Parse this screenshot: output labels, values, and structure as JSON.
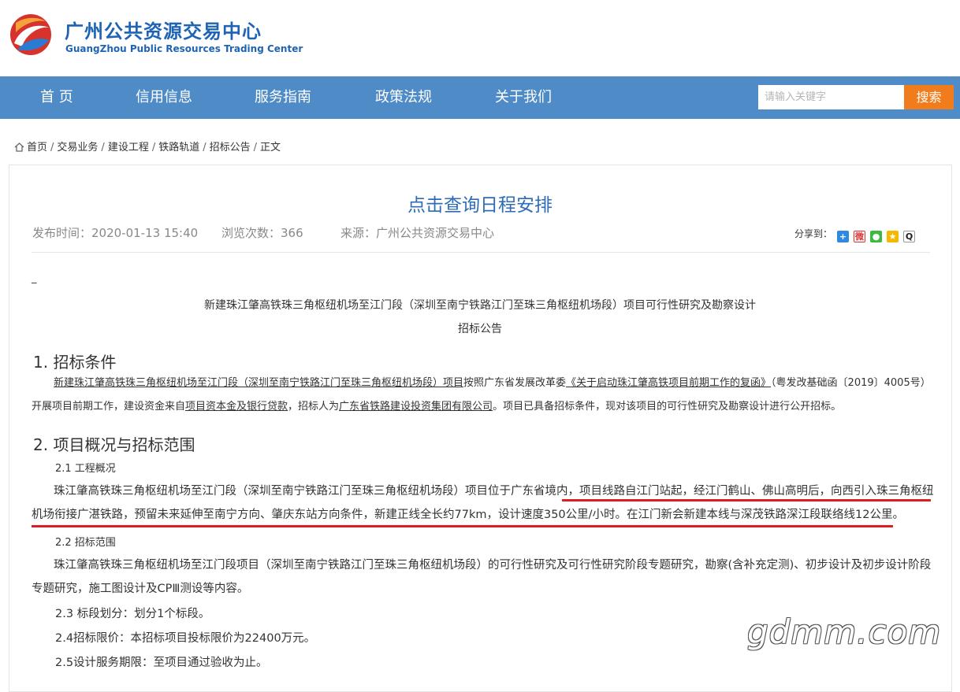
{
  "header": {
    "title": "广州公共资源交易中心",
    "subtitle": "GuangZhou Public Resources Trading Center",
    "logo_icon": "swirl-logo-icon"
  },
  "nav": {
    "items": [
      "首 页",
      "信用信息",
      "服务指南",
      "政策法规",
      "关于我们"
    ],
    "search_placeholder": "请输入关键字",
    "search_button": "搜索"
  },
  "breadcrumb": {
    "items": [
      "首页",
      "交易业务",
      "建设工程",
      "铁路轨道",
      "招标公告",
      "正文"
    ],
    "separator": "/"
  },
  "article": {
    "title": "点击查询日程安排",
    "publish_time": "发布时间：2020-01-13 15:40",
    "views": "浏览次数：366",
    "source": "来源：广州公共资源交易中心",
    "share_label": "分享到：",
    "dash": "_",
    "heading_line1": "新建珠江肇高铁珠三角枢纽机场至江门段（深圳至南宁铁路江门至珠三角枢纽机场段）项目可行性研究及勘察设计",
    "heading_line2": "招标公告"
  },
  "sections": {
    "s1_title": "1. 招标条件",
    "s1_p_a": "新建珠江肇高铁珠三角枢纽机场至江门段（深圳至南宁铁路江门至珠三角枢纽机场段）项目",
    "s1_p_b": "按照广东省发展改革委",
    "s1_p_c": "《关于启动珠江肇高铁项目前期工作的复函》",
    "s1_p_d": "（粤发改基础函〔2019〕4005号）开展项目前期工作，建设资金来自",
    "s1_p_e": "项目资本金及银行贷款",
    "s1_p_f": "，招标人为",
    "s1_p_g": "广东省铁路建设投资集团有限公司",
    "s1_p_h": "。项目已具备招标条件，现对该项目的可行性研究及勘察设计进行公开招标。",
    "s2_title": "2. 项目概况与招标范围",
    "s2_1": "2.1 工程概况",
    "s2_1_p": "珠江肇高铁珠三角枢纽机场至江门段（深圳至南宁铁路江门至珠三角枢纽机场段）项目位于广东省境内，项目线路自江门站起，经江门鹤山、佛山高明后，向西引入珠三角枢纽机场衔接广湛铁路，预留未来延伸至南宁方向、肇庆东站方向条件，新建正线全长约77km，设计速度350公里/小时。在江门新会新建本线与深茂铁路深江段联络线12公里。",
    "s2_2": "2.2 招标范围",
    "s2_2_p": "珠江肇高铁珠三角枢纽机场至江门段项目（深圳至南宁铁路江门至珠三角枢纽机场段）的可行性研究及可行性研究阶段专题研究，勘察(含补充定测)、初步设计及初步设计阶段专题研究，施工图设计及CPⅢ测设等内容。",
    "s2_3": "2.3 标段划分：划分1个标段。",
    "s2_4": "2.4招标限价：本招标项目投标限价为22400万元。",
    "s2_5": "2.5设计服务期限：至项目通过验收为止。"
  },
  "watermark": "gdmm.com",
  "colors": {
    "brand_blue": "#1f64b4",
    "nav_bg": "#4f8bc6",
    "search_button": "#f07c1c",
    "title_blue": "#2e6cb5",
    "highlight_red": "#e01b24"
  }
}
